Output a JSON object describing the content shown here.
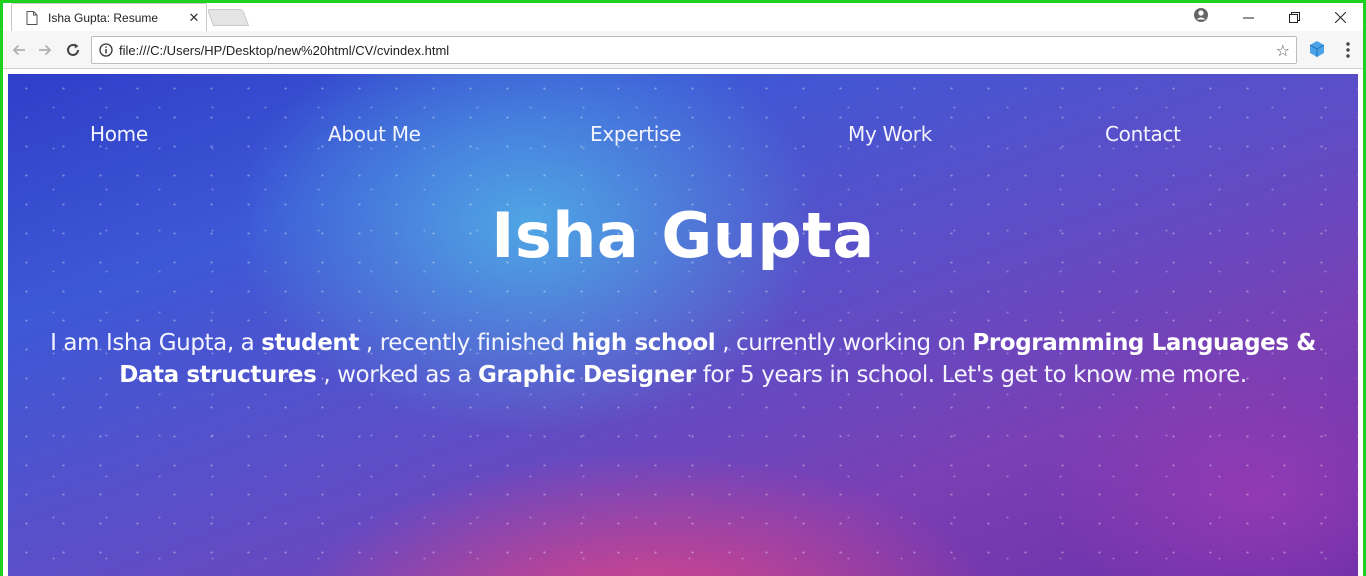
{
  "browser": {
    "tab": {
      "title": "Isha Gupta: Resume",
      "close": "✕"
    },
    "url": "file:///C:/Users/HP/Desktop/new%20html/CV/cvindex.html"
  },
  "site": {
    "nav": [
      "Home",
      "About Me",
      "Expertise",
      "My Work",
      "Contact"
    ],
    "name": "Isha Gupta",
    "intro": [
      {
        "text": "I am Isha Gupta, a ",
        "bold": false
      },
      {
        "text": "student",
        "bold": true
      },
      {
        "text": " , recently finished ",
        "bold": false
      },
      {
        "text": "high school",
        "bold": true
      },
      {
        "text": " , currently working on ",
        "bold": false
      },
      {
        "text": "Programming Languages & Data structures",
        "bold": true
      },
      {
        "text": " , worked as a ",
        "bold": false
      },
      {
        "text": "Graphic Designer",
        "bold": true
      },
      {
        "text": " for 5 years in school. Let's get to know me more.",
        "bold": false
      }
    ]
  }
}
